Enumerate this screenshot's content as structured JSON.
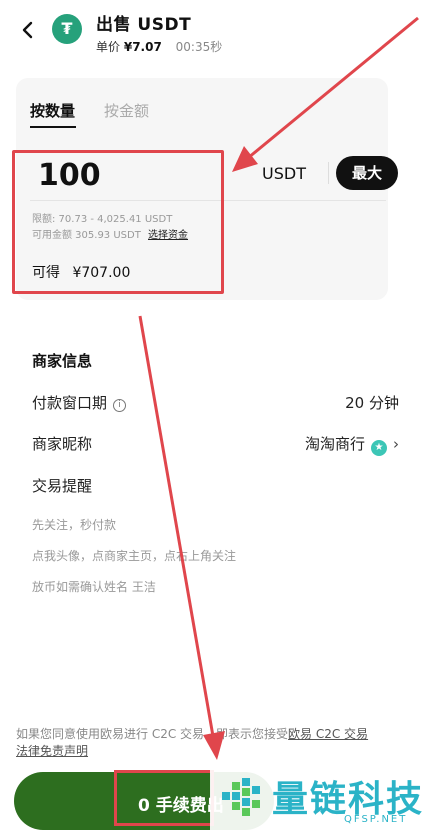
{
  "header": {
    "title": "出售 USDT",
    "price_label": "单价",
    "price_value": "¥7.07",
    "timer": "00:35秒",
    "coin_symbol": "₮"
  },
  "trade": {
    "tabs": [
      {
        "label": "按数量",
        "active": true
      },
      {
        "label": "按金额",
        "active": false
      }
    ],
    "amount": "100",
    "unit": "USDT",
    "max_label": "最大",
    "limit_text": "限额: 70.73 - 4,025.41 USDT",
    "available_text": "可用金额 305.93 USDT",
    "select_funds_label": "选择资金",
    "receive_label": "可得",
    "receive_amount": "¥707.00"
  },
  "merchant": {
    "section_title": "商家信息",
    "payment_window_label": "付款窗口期",
    "payment_window_value": "20 分钟",
    "nickname_label": "商家昵称",
    "nickname_value": "淘淘商行",
    "reminder_label": "交易提醒",
    "notes": [
      "先关注，秒付款",
      "点我头像，点商家主页，点右上角关注",
      "放币如需确认姓名 王洁"
    ]
  },
  "disclaimer": {
    "text": "如果您同意使用欧易进行 C2C 交易，即表示您接受",
    "link1": "欧易 C2C 交易",
    "link2": "法律免责声明"
  },
  "cta": {
    "label": "0 手续费出"
  },
  "watermark": {
    "text": "量链科技",
    "sub": "QFSP.NET"
  },
  "colors": {
    "annotation_red": "#e0464c",
    "cta_green": "#2d6e1f",
    "tether_green": "#26a17b",
    "watermark_teal": "#2bb3c7"
  }
}
